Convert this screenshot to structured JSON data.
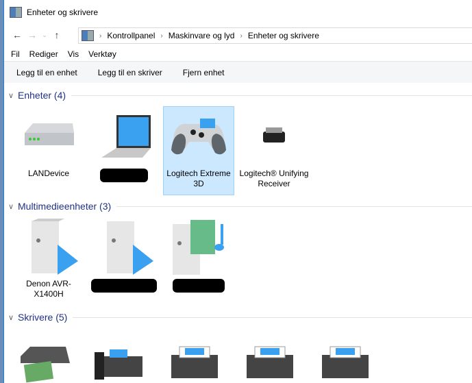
{
  "window": {
    "title": "Enheter og skrivere"
  },
  "breadcrumb": [
    "Kontrollpanel",
    "Maskinvare og lyd",
    "Enheter og skrivere"
  ],
  "menu": [
    "Fil",
    "Rediger",
    "Vis",
    "Verktøy"
  ],
  "commands": [
    "Legg til en enhet",
    "Legg til en skriver",
    "Fjern enhet"
  ],
  "groups": {
    "devices": {
      "label": "Enheter (4)",
      "items": [
        {
          "label": "LANDevice"
        },
        {
          "label": ""
        },
        {
          "label": "Logitech Extreme 3D",
          "selected": true
        },
        {
          "label": "Logitech® Unifying Receiver"
        }
      ]
    },
    "media": {
      "label": "Multimedieenheter (3)",
      "items": [
        {
          "label": "Denon AVR-X1400H"
        },
        {
          "label": ""
        },
        {
          "label": ""
        }
      ]
    },
    "printers": {
      "label": "Skrivere (5)"
    }
  },
  "colors": {
    "selection": "#cce8ff",
    "group_header": "#1e3287"
  }
}
